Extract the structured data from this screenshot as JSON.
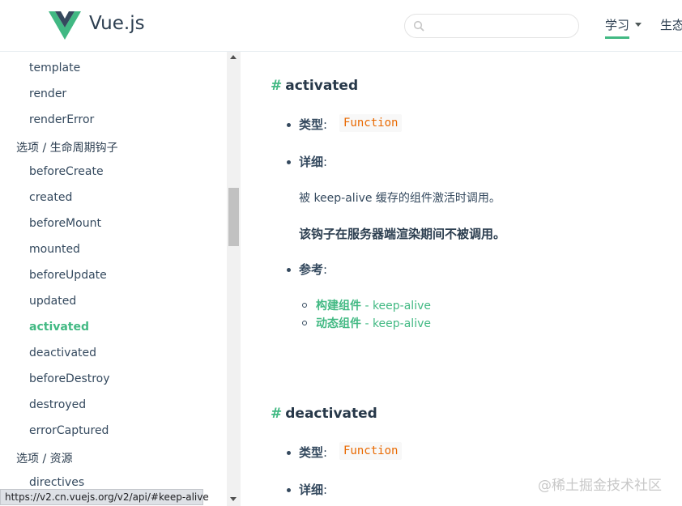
{
  "header": {
    "brand": "Vue.js",
    "search_placeholder": "",
    "nav_learn": "学习",
    "nav_ecosystem": "生态"
  },
  "sidebar": {
    "items": [
      {
        "label": "template",
        "type": "item"
      },
      {
        "label": "render",
        "type": "item"
      },
      {
        "label": "renderError",
        "type": "item"
      },
      {
        "label": "选项 / 生命周期钩子",
        "type": "section"
      },
      {
        "label": "beforeCreate",
        "type": "item"
      },
      {
        "label": "created",
        "type": "item"
      },
      {
        "label": "beforeMount",
        "type": "item"
      },
      {
        "label": "mounted",
        "type": "item"
      },
      {
        "label": "beforeUpdate",
        "type": "item"
      },
      {
        "label": "updated",
        "type": "item"
      },
      {
        "label": "activated",
        "type": "item",
        "active": true
      },
      {
        "label": "deactivated",
        "type": "item"
      },
      {
        "label": "beforeDestroy",
        "type": "item"
      },
      {
        "label": "destroyed",
        "type": "item"
      },
      {
        "label": "errorCaptured",
        "type": "item"
      },
      {
        "label": "选项 / 资源",
        "type": "section"
      },
      {
        "label": "directives",
        "type": "item"
      }
    ]
  },
  "status_url": "https://v2.cn.vuejs.org/v2/api/#keep-alive",
  "content": {
    "activated": {
      "hash": "#",
      "title": "activated",
      "type_label": "类型",
      "colon": ":",
      "type_value": "Function",
      "detail_label": "详细",
      "detail_text": "被 keep-alive 缓存的组件激活时调用。",
      "detail_bold": "该钩子在服务器端渲染期间不被调用。",
      "see_label": "参考",
      "links": [
        {
          "bold": "构建组件",
          "rest": " - keep-alive"
        },
        {
          "bold": "动态组件",
          "rest": " - keep-alive"
        }
      ]
    },
    "deactivated": {
      "hash": "#",
      "title": "deactivated",
      "type_label": "类型",
      "colon": ":",
      "type_value": "Function",
      "detail_label": "详细"
    }
  },
  "watermark": "@稀土掘金技术社区",
  "colors": {
    "accent": "#42b983",
    "text": "#34495e",
    "code": "#e96900"
  }
}
